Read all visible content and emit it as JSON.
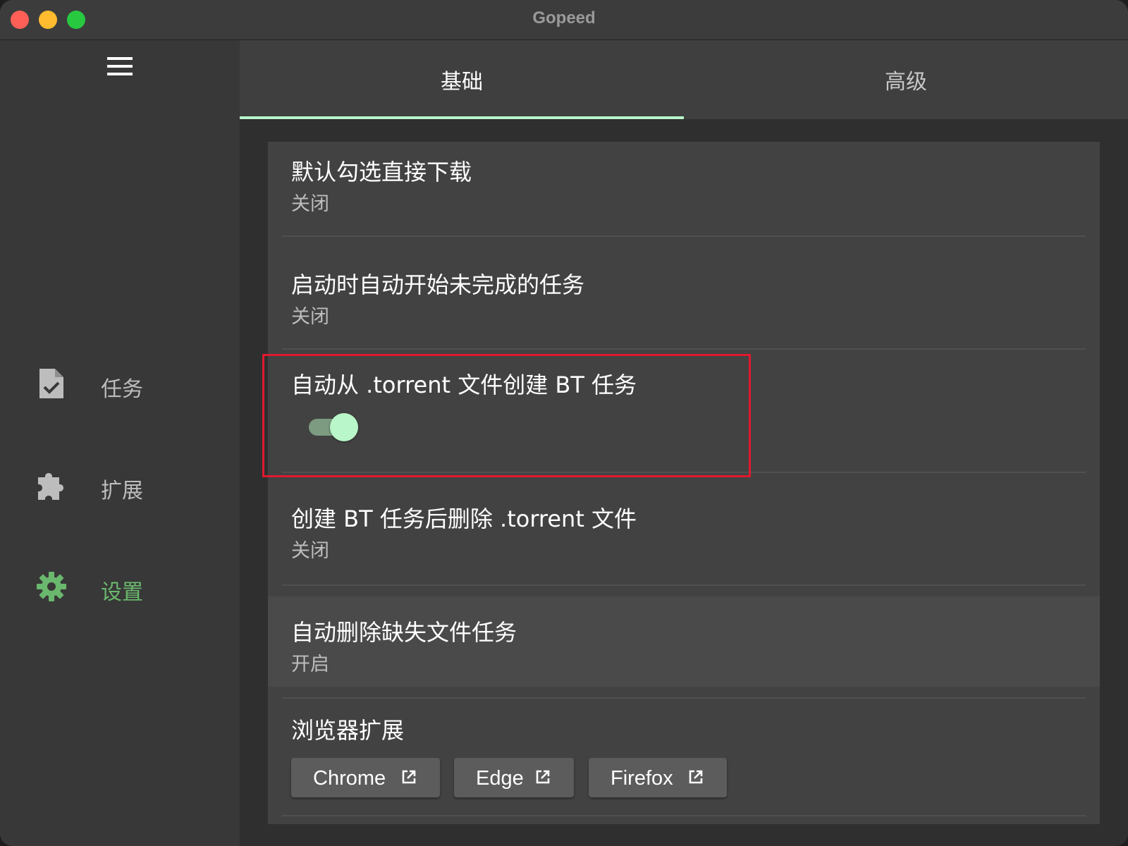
{
  "window": {
    "title": "Gopeed"
  },
  "sidebar": {
    "items": [
      {
        "label": "任务",
        "icon": "task-file-icon"
      },
      {
        "label": "扩展",
        "icon": "puzzle-icon"
      },
      {
        "label": "设置",
        "icon": "gear-icon",
        "active": true
      }
    ]
  },
  "tabs": [
    {
      "label": "基础",
      "active": true
    },
    {
      "label": "高级",
      "active": false
    }
  ],
  "settings": [
    {
      "title": "默认勾选直接下载",
      "value": "关闭"
    },
    {
      "title": "启动时自动开始未完成的任务",
      "value": "关闭"
    },
    {
      "title": "自动从 .torrent 文件创建 BT 任务",
      "toggle": true
    },
    {
      "title": "创建 BT 任务后删除 .torrent 文件",
      "value": "关闭"
    },
    {
      "title": "自动删除缺失文件任务",
      "value": "开启"
    },
    {
      "title": "浏览器扩展"
    }
  ],
  "browser_extensions": [
    "Chrome",
    "Edge",
    "Firefox"
  ],
  "colors": {
    "accent": "#b9f6ca",
    "active_nav": "#6ab86d",
    "highlight": "#e0192e"
  }
}
